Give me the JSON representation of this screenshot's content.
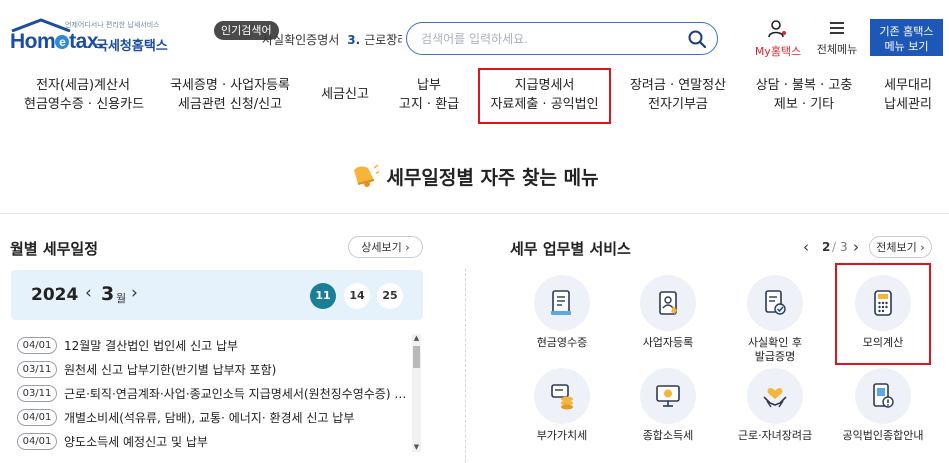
{
  "header": {
    "logo_tagline": "언제어디서나 편리한 납세서비스",
    "logo_text_main": "Hom",
    "logo_text_e": "e",
    "logo_text_rest": "tax.",
    "logo_sub": "국세청홈택스",
    "popular_badge": "인기검색어",
    "popular_prev": "사실확인증명서",
    "popular_rank": "3.",
    "popular_term": "근로장려금",
    "search_placeholder": "검색어를 입력하세요.",
    "my_hometax_label": "My홈택스",
    "all_menu_label": "전체메뉴",
    "classic_line1": "기존 홈택스",
    "classic_line2": "메뉴 보기"
  },
  "nav": {
    "items": [
      {
        "line1": "전자(세금)계산서",
        "line2": "현금영수증 · 신용카드"
      },
      {
        "line1": "국세증명 · 사업자등록",
        "line2": "세금관련 신청/신고"
      },
      {
        "line1": "세금신고",
        "line2": ""
      },
      {
        "line1": "납부",
        "line2": "고지 · 환급"
      },
      {
        "line1": "지급명세서",
        "line2": "자료제출 · 공익법인"
      },
      {
        "line1": "장려금 · 연말정산",
        "line2": "전자기부금"
      },
      {
        "line1": "상담 · 불복 · 고충",
        "line2": "제보 · 기타"
      },
      {
        "line1": "세무대리",
        "line2": "납세관리"
      }
    ]
  },
  "section_title": "세무일정별 자주 찾는 메뉴",
  "monthly": {
    "title": "월별 세무일정",
    "detail_btn": "상세보기 ›",
    "year": "2024",
    "month": "3",
    "month_unit": "월",
    "days": [
      "11",
      "14",
      "25"
    ],
    "active_day": "11",
    "schedule": [
      {
        "date": "04/01",
        "text": "12월말 결산법인 법인세 신고 납부"
      },
      {
        "date": "03/11",
        "text": "원천세 신고 납부기한(반기별 납부자 포함)"
      },
      {
        "date": "03/11",
        "text": "근로·퇴직·연금계좌·사업·종교인소득 지급명세서(원천징수영수증) 제출"
      },
      {
        "date": "04/01",
        "text": "개별소비세(석유류, 담배), 교통· 에너지· 환경세 신고 납부"
      },
      {
        "date": "04/01",
        "text": "양도소득세 예정신고 및 납부"
      }
    ]
  },
  "services": {
    "title": "세무 업무별 서비스",
    "page_current": "2",
    "page_sep": "/",
    "page_total": "3",
    "full_view_btn": "전체보기 ›",
    "items": [
      {
        "label": "현금영수증",
        "icon": "receipt-icon"
      },
      {
        "label": "사업자등록",
        "icon": "business-registration-icon"
      },
      {
        "label": "사실확인 후\n발급증명",
        "icon": "certificate-check-icon"
      },
      {
        "label": "모의계산",
        "icon": "calculator-icon"
      },
      {
        "label": "부가가치세",
        "icon": "vat-coins-icon"
      },
      {
        "label": "종합소득세",
        "icon": "income-tax-monitor-icon"
      },
      {
        "label": "근로·자녀장려금",
        "icon": "incentive-hands-icon"
      },
      {
        "label": "공익법인종합안내",
        "icon": "public-corp-info-icon"
      }
    ]
  },
  "colors": {
    "brand_blue": "#1b4ea0",
    "highlight_red": "#e0141e",
    "active_day": "#1a7f96",
    "calendar_bg": "#e6f2fb"
  }
}
